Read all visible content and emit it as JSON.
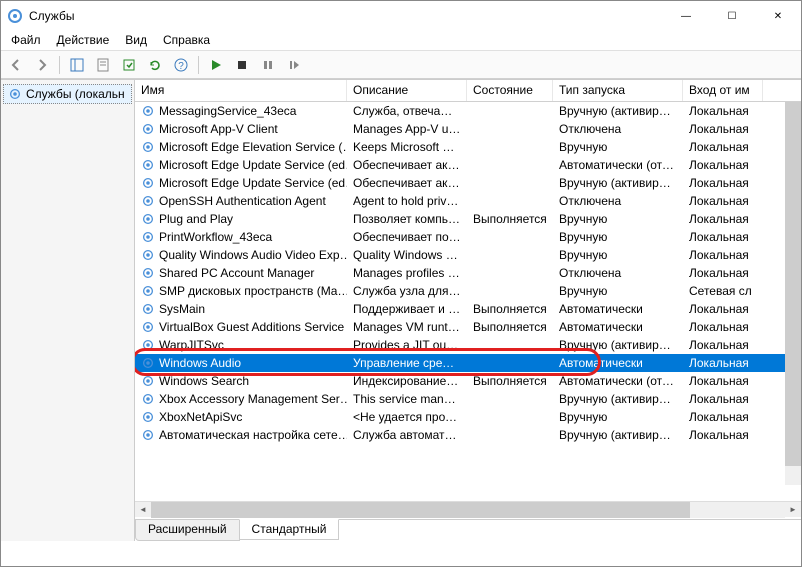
{
  "window": {
    "title": "Службы",
    "min": "—",
    "max": "☐",
    "close": "✕"
  },
  "menu": {
    "file": "Файл",
    "action": "Действие",
    "view": "Вид",
    "help": "Справка"
  },
  "sidebar": {
    "node_label": "Службы (локальн"
  },
  "columns": {
    "name": "Имя",
    "desc": "Описание",
    "state": "Состояние",
    "startup": "Тип запуска",
    "logon": "Вход от им"
  },
  "rows": [
    {
      "name": "MessagingService_43eca",
      "desc": "Служба, отвечаю…",
      "state": "",
      "startup": "Вручную (активиро…",
      "logon": "Локальная"
    },
    {
      "name": "Microsoft App-V Client",
      "desc": "Manages App-V us…",
      "state": "",
      "startup": "Отключена",
      "logon": "Локальная"
    },
    {
      "name": "Microsoft Edge Elevation Service (…",
      "desc": "Keeps Microsoft E…",
      "state": "",
      "startup": "Вручную",
      "logon": "Локальная"
    },
    {
      "name": "Microsoft Edge Update Service (ed…",
      "desc": "Обеспечивает акт…",
      "state": "",
      "startup": "Автоматически (отл…",
      "logon": "Локальная"
    },
    {
      "name": "Microsoft Edge Update Service (ed…",
      "desc": "Обеспечивает акт…",
      "state": "",
      "startup": "Вручную (активиро…",
      "logon": "Локальная"
    },
    {
      "name": "OpenSSH Authentication Agent",
      "desc": "Agent to hold priv…",
      "state": "",
      "startup": "Отключена",
      "logon": "Локальная"
    },
    {
      "name": "Plug and Play",
      "desc": "Позволяет компь…",
      "state": "Выполняется",
      "startup": "Вручную",
      "logon": "Локальная"
    },
    {
      "name": "PrintWorkflow_43eca",
      "desc": "Обеспечивает по…",
      "state": "",
      "startup": "Вручную",
      "logon": "Локальная"
    },
    {
      "name": "Quality Windows Audio Video Exp…",
      "desc": "Quality Windows …",
      "state": "",
      "startup": "Вручную",
      "logon": "Локальная"
    },
    {
      "name": "Shared PC Account Manager",
      "desc": "Manages profiles a…",
      "state": "",
      "startup": "Отключена",
      "logon": "Локальная"
    },
    {
      "name": "SMP дисковых пространств (Ma…",
      "desc": "Служба узла для …",
      "state": "",
      "startup": "Вручную",
      "logon": "Сетевая сл"
    },
    {
      "name": "SysMain",
      "desc": "Поддерживает и у…",
      "state": "Выполняется",
      "startup": "Автоматически",
      "logon": "Локальная"
    },
    {
      "name": "VirtualBox Guest Additions Service",
      "desc": "Manages VM runti…",
      "state": "Выполняется",
      "startup": "Автоматически",
      "logon": "Локальная"
    },
    {
      "name": "WarpJITSvc",
      "desc": "Provides a JIT out …",
      "state": "",
      "startup": "Вручную (активиро…",
      "logon": "Локальная"
    },
    {
      "name": "Windows Audio",
      "desc": "Управление средс…",
      "state": "",
      "startup": "Автоматически",
      "logon": "Локальная",
      "selected": true
    },
    {
      "name": "Windows Search",
      "desc": "Индексирование …",
      "state": "Выполняется",
      "startup": "Автоматически (отл…",
      "logon": "Локальная"
    },
    {
      "name": "Xbox Accessory Management Ser…",
      "desc": "This service manag…",
      "state": "",
      "startup": "Вручную (активиро…",
      "logon": "Локальная"
    },
    {
      "name": "XboxNetApiSvc",
      "desc": "<Не удается проч…",
      "state": "",
      "startup": "Вручную",
      "logon": "Локальная"
    },
    {
      "name": "Автоматическая настройка сете…",
      "desc": "Служба автомати…",
      "state": "",
      "startup": "Вручную (активиро…",
      "logon": "Локальная"
    }
  ],
  "tabs": {
    "extended": "Расширенный",
    "standard": "Стандартный"
  }
}
